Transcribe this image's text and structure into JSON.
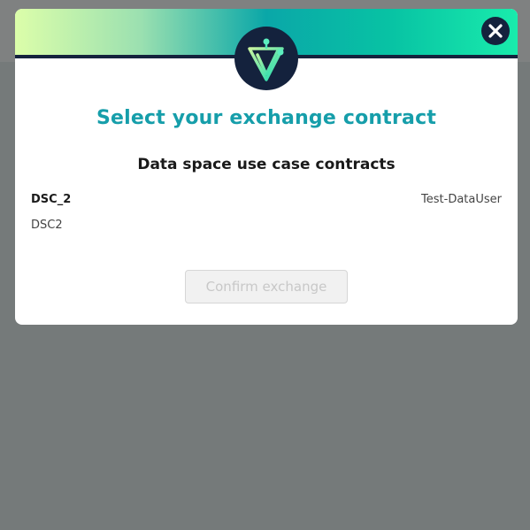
{
  "modal": {
    "title": "Select your exchange contract",
    "section_title": "Data space use case contracts",
    "contracts": [
      {
        "name": "DSC_2",
        "owner": "Test-DataUser",
        "description": "DSC2"
      }
    ],
    "confirm_label": "Confirm exchange",
    "confirm_enabled": false
  },
  "icons": {
    "close": "close-icon",
    "logo": "brand-logo-icon"
  },
  "colors": {
    "accent_title": "#169eaa",
    "header_dark": "#14223d",
    "gradient_start": "#dcfeaa",
    "gradient_mid": "#0aa7a8",
    "gradient_end": "#19ecac"
  }
}
